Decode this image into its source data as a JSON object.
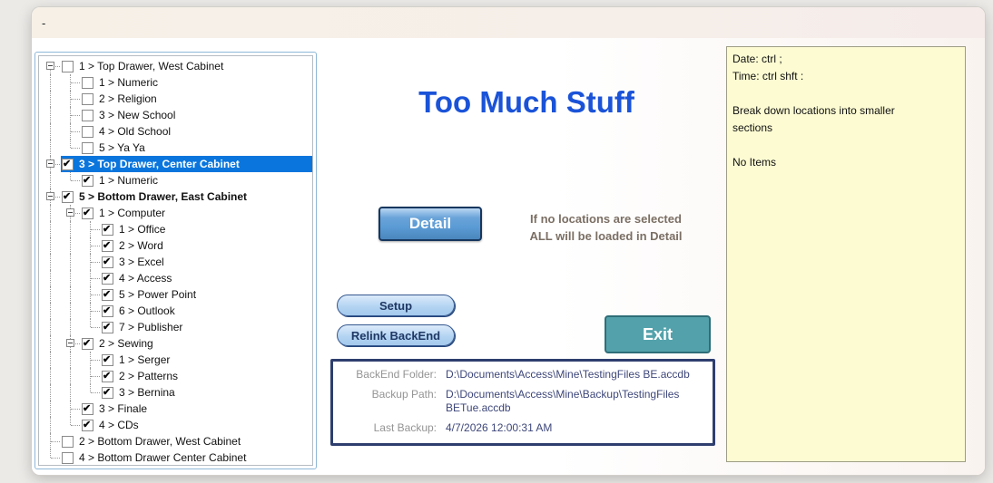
{
  "window": {
    "title_text": "-"
  },
  "tree": {
    "rows": [
      {
        "label": "1 > Top Drawer, West Cabinet",
        "level": 0,
        "checked": false,
        "expander": true
      },
      {
        "label": "1 > Numeric",
        "level": 1,
        "checked": false
      },
      {
        "label": "2 > Religion",
        "level": 1,
        "checked": false
      },
      {
        "label": "3 > New School",
        "level": 1,
        "checked": false
      },
      {
        "label": "4 > Old School",
        "level": 1,
        "checked": false
      },
      {
        "label": "5 > Ya Ya",
        "level": 1,
        "checked": false
      },
      {
        "label": "3 > Top Drawer, Center Cabinet",
        "level": 0,
        "checked": true,
        "expander": true,
        "selected": true,
        "bold": true
      },
      {
        "label": "1 > Numeric",
        "level": 1,
        "checked": true
      },
      {
        "label": "5 > Bottom Drawer, East Cabinet",
        "level": 0,
        "checked": true,
        "expander": true,
        "bold": true
      },
      {
        "label": "1 > Computer",
        "level": 1,
        "checked": true,
        "expander": true
      },
      {
        "label": "1 > Office",
        "level": 2,
        "checked": true
      },
      {
        "label": "2 > Word",
        "level": 2,
        "checked": true
      },
      {
        "label": "3 > Excel",
        "level": 2,
        "checked": true
      },
      {
        "label": "4 > Access",
        "level": 2,
        "checked": true
      },
      {
        "label": "5 > Power Point",
        "level": 2,
        "checked": true
      },
      {
        "label": "6 > Outlook",
        "level": 2,
        "checked": true
      },
      {
        "label": "7 > Publisher",
        "level": 2,
        "checked": true
      },
      {
        "label": "2 > Sewing",
        "level": 1,
        "checked": true,
        "expander": true
      },
      {
        "label": "1 > Serger",
        "level": 2,
        "checked": true
      },
      {
        "label": "2 > Patterns",
        "level": 2,
        "checked": true
      },
      {
        "label": "3 > Bernina",
        "level": 2,
        "checked": true
      },
      {
        "label": "3 > Finale",
        "level": 1,
        "checked": true
      },
      {
        "label": "4 > CDs",
        "level": 1,
        "checked": true
      },
      {
        "label": "2 > Bottom Drawer, West Cabinet",
        "level": 0,
        "checked": false
      },
      {
        "label": "4 > Bottom Drawer Center Cabinet",
        "level": 0,
        "checked": false
      }
    ]
  },
  "main": {
    "title": "Too Much Stuff",
    "detail_button": "Detail",
    "detail_note_line1": "If no locations are selected",
    "detail_note_line2": "ALL will be loaded in Detail",
    "setup_button": "Setup",
    "relink_button": "Relink BackEnd",
    "exit_button": "Exit"
  },
  "backend": {
    "rows": [
      {
        "label": "BackEnd Folder:",
        "value": "D:\\Documents\\Access\\Mine\\TestingFiles BE.accdb"
      },
      {
        "label": "Backup Path:",
        "value": "D:\\Documents\\Access\\Mine\\Backup\\TestingFiles BETue.accdb"
      },
      {
        "label": "Last Backup:",
        "value": "4/7/2026 12:00:31 AM"
      }
    ]
  },
  "notes": {
    "lines": [
      "Date: ctrl ;",
      "Time: ctrl shft :",
      "",
      "Break down locations into smaller sections",
      "",
      "No Items"
    ]
  },
  "colors": {
    "title_blue": "#1a53d8",
    "selection_blue": "#0a76dd",
    "detail_button_blue": "#5b9bd5",
    "pill_button_blue": "#b4d4f2",
    "exit_teal": "#53a2ab",
    "backend_border_navy": "#2e3e6e",
    "notes_yellow": "#fcfbd2"
  }
}
